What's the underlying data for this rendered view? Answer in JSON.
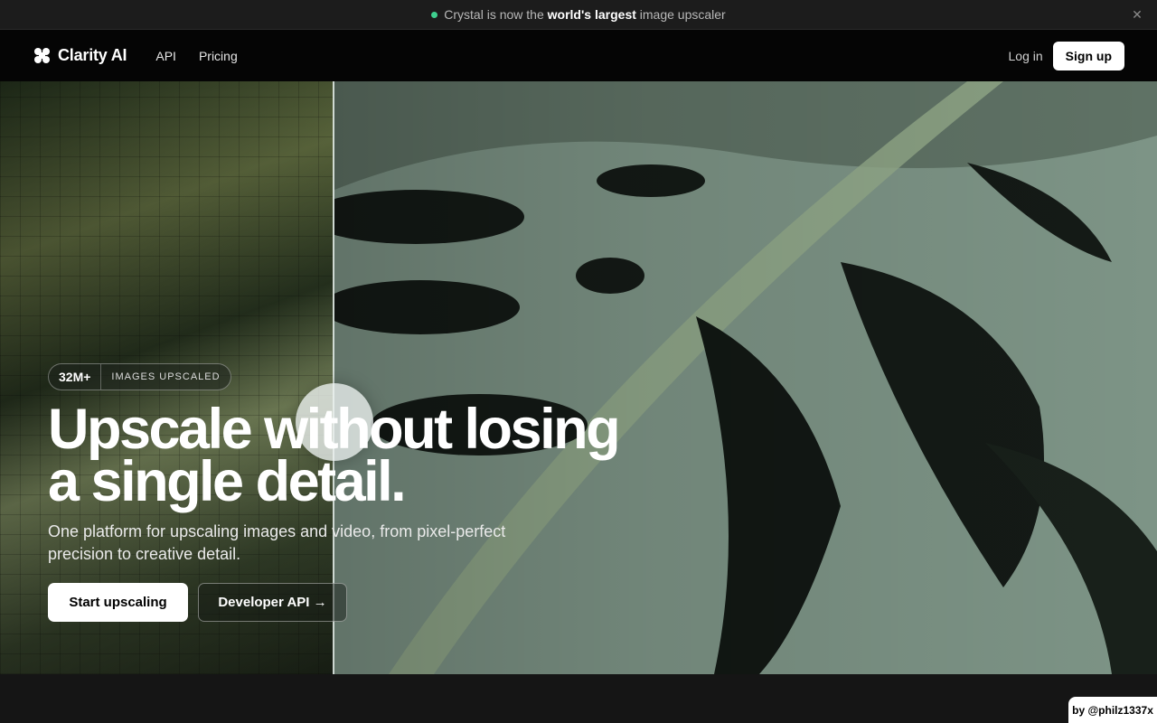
{
  "announcement": {
    "text_pre": "Crystal is now the ",
    "text_bold": "world's largest",
    "text_post": " image upscaler",
    "dot_color": "#3ecf8e",
    "close_icon": "close-icon"
  },
  "nav": {
    "brand": "Clarity AI",
    "links": [
      "API",
      "Pricing"
    ],
    "login": "Log in",
    "signup": "Sign up"
  },
  "hero": {
    "badge_count": "32M+",
    "badge_label": "IMAGES UPSCALED",
    "headline_line1": "Upscale without losing",
    "headline_line2": "a single detail.",
    "subhead": "One platform for upscaling images and video, from pixel-perfect precision to creative detail.",
    "cta_primary": "Start upscaling",
    "cta_secondary": "Developer API →"
  },
  "credit": "by @philz1337x"
}
